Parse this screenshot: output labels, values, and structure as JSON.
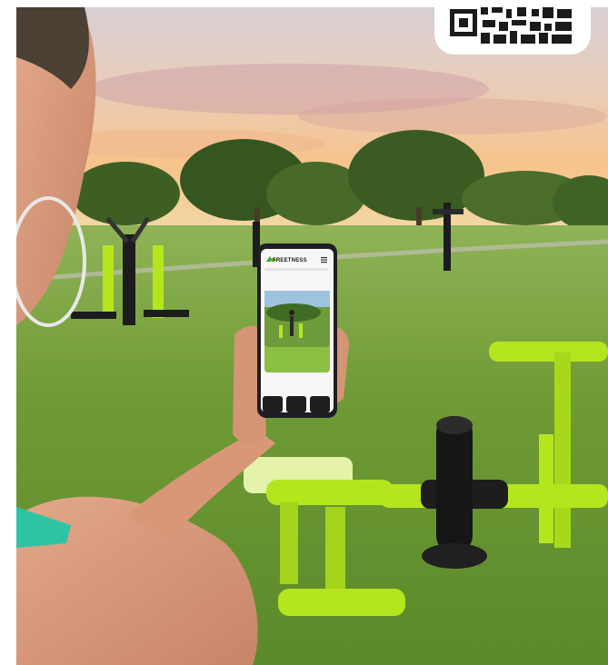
{
  "phone": {
    "brand": "FREETNESS"
  },
  "colors": {
    "accent_green": "#b5e61d",
    "grass": "#5f8f2a",
    "sky_top": "#e9d6c8",
    "sunset": "#f6b27a",
    "qr_ink": "#1b1b1b"
  },
  "icons": [
    "freetness-logo-icon",
    "menu-icon",
    "back-arrow-icon",
    "qr-code-icon"
  ]
}
